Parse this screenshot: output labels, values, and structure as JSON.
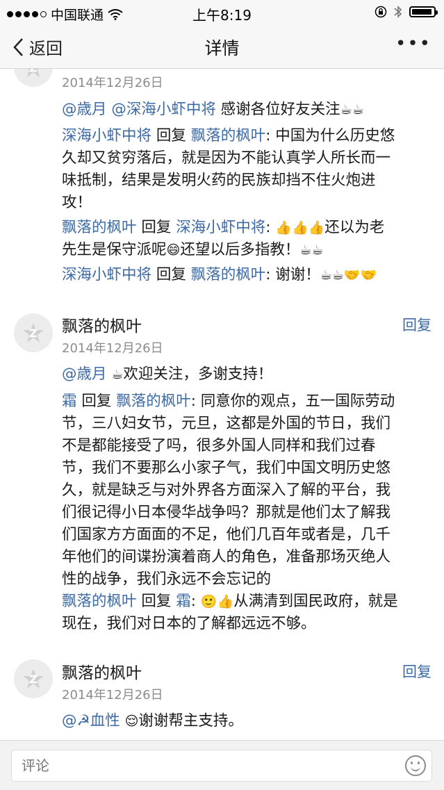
{
  "status": {
    "carrier": "中国联通",
    "time": "上午8:19"
  },
  "nav": {
    "back": "返回",
    "title": "详情"
  },
  "comments": [
    {
      "date": "2014年12月26日",
      "lines": [
        [
          "@歳月 @深海小虾中将 ",
          "感谢各位好友关注",
          "☕☕"
        ],
        [
          "深海小虾中将",
          " 回复 ",
          "飘落的枫叶",
          ": 中国为什么历史悠"
        ],
        [
          "久却又贫穷落后，就是因为不能认真学人所长而一"
        ],
        [
          "味抵制，结果是发明火药的民族却挡不住火炮进"
        ],
        [
          "攻！"
        ],
        [
          "飘落的枫叶",
          " 回复 ",
          "深海小虾中将",
          ": ",
          "👍👍👍",
          "还以为老"
        ],
        [
          "先生是保守派呢",
          "😄",
          "还望以后多指教！",
          "☕☕"
        ],
        [
          "深海小虾中将",
          " 回复 ",
          "飘落的枫叶",
          ": 谢谢！",
          "☕☕🤝🤝"
        ]
      ]
    },
    {
      "author": "飘落的枫叶",
      "reply": "回复",
      "date": "2014年12月26日",
      "lines": [
        [
          "@歳月 ",
          "☕",
          "欢迎关注，多谢支持！"
        ],
        [
          "霜",
          " 回复 ",
          "飘落的枫叶",
          ": 同意你的观点，五一国际劳动"
        ],
        [
          "节，三八妇女节，元旦，这都是外国的节日，我们"
        ],
        [
          "不是都能接受了吗，很多外国人同样和我们过春"
        ],
        [
          "节，我们不要那么小家子气，我们中国文明历史悠"
        ],
        [
          "久，就是缺乏与对外界各方面深入了解的平台，我"
        ],
        [
          "们很记得小日本侵华战争吗？那就是他们太了解我"
        ],
        [
          "们国家方方面面的不足，他们几百年或者是，几千"
        ],
        [
          "年他们的间谍扮演着商人的角色，准备那场灭绝人"
        ],
        [
          "性的战争，我们永远不会忘记的"
        ],
        [
          "飘落的枫叶",
          " 回复 ",
          "霜",
          ": ",
          "🙂👍",
          "从满清到国民政府，就是"
        ],
        [
          "现在，我们对日本的了解都远远不够。"
        ]
      ]
    },
    {
      "author": "飘落的枫叶",
      "reply": "回复",
      "date": "2014年12月26日",
      "lines": [
        [
          "@☭血性 ",
          "😌",
          "谢谢帮主支持。"
        ]
      ]
    }
  ],
  "comment_input": {
    "placeholder": "评论"
  },
  "colors": {
    "link": "#3c6aa4",
    "meta": "#8c8c8c",
    "bar": "#f7f7f7"
  },
  "icons": [
    "signal-dots-icon",
    "wifi-icon",
    "orientation-lock-icon",
    "bluetooth-icon",
    "battery-icon",
    "back-chevron-icon",
    "more-icon",
    "avatar-placeholder-icon",
    "emoji-icon"
  ]
}
